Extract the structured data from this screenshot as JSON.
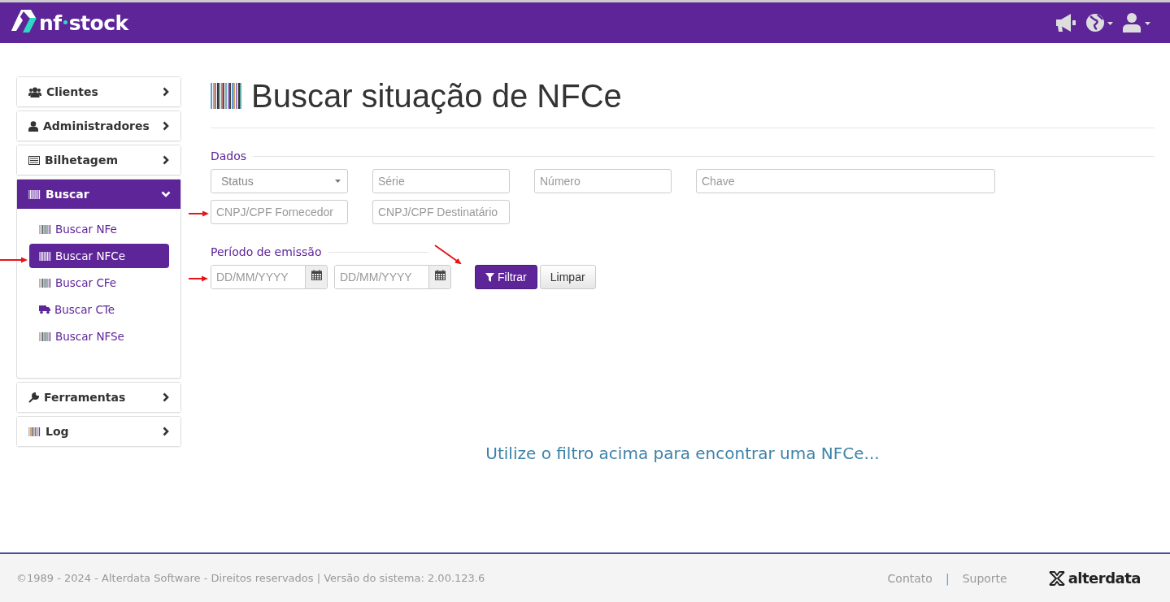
{
  "header": {
    "logo": {
      "prefix": "nf",
      "suffix": "stock"
    }
  },
  "sidebar": {
    "items": [
      {
        "label": "Clientes",
        "expanded": false
      },
      {
        "label": "Administradores",
        "expanded": false
      },
      {
        "label": "Bilhetagem",
        "expanded": false
      },
      {
        "label": "Buscar",
        "expanded": true,
        "children": [
          {
            "label": "Buscar NFe",
            "selected": false
          },
          {
            "label": "Buscar NFCe",
            "selected": true
          },
          {
            "label": "Buscar CFe",
            "selected": false
          },
          {
            "label": "Buscar CTe",
            "selected": false
          },
          {
            "label": "Buscar NFSe",
            "selected": false
          }
        ]
      },
      {
        "label": "Ferramentas",
        "expanded": false
      },
      {
        "label": "Log",
        "expanded": false
      }
    ]
  },
  "page": {
    "title": "Buscar situação de NFCe",
    "dados": {
      "legend": "Dados",
      "rows": [
        [
          {
            "kind": "select",
            "placeholder": "Status"
          },
          {
            "kind": "input",
            "placeholder": "Série"
          },
          {
            "kind": "input",
            "placeholder": "Número"
          },
          {
            "kind": "wide",
            "placeholder": "Chave"
          }
        ],
        [
          {
            "kind": "input",
            "placeholder": "CNPJ/CPF Fornecedor"
          },
          {
            "kind": "input",
            "placeholder": "CNPJ/CPF Destinatário"
          }
        ]
      ]
    },
    "periodo": {
      "legend": "Período de emissão",
      "dates": [
        {
          "placeholder": "DD/MM/YYYY"
        },
        {
          "placeholder": "DD/MM/YYYY"
        }
      ]
    },
    "buttons": [
      {
        "kind": "primary",
        "label": "Filtrar"
      },
      {
        "kind": "default",
        "label": "Limpar"
      }
    ],
    "message": "Utilize o filtro acima para encontrar uma NFCe..."
  },
  "footer": {
    "copyright": "©1989 - 2024 - Alterdata Software - Direitos reservados | Versão do sistema: 2.00.123.6",
    "links": [
      "Contato",
      "Suporte"
    ],
    "separator": "|",
    "brand": "alterdata"
  }
}
